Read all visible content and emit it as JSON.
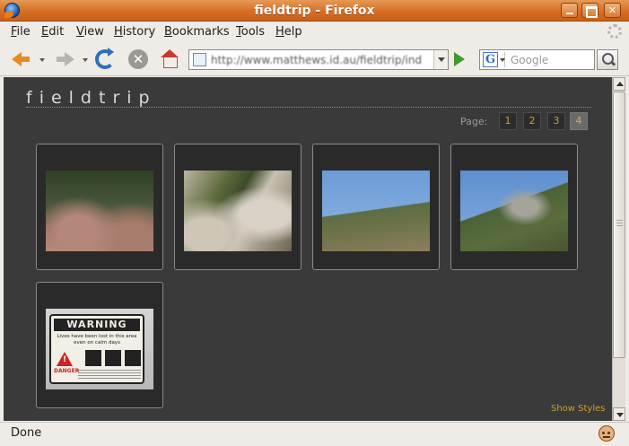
{
  "window": {
    "title": "fieldtrip - Firefox",
    "app_icon": "firefox-globe-icon"
  },
  "menubar": {
    "items": [
      {
        "label": "File",
        "accel": "F",
        "rest": "ile"
      },
      {
        "label": "Edit",
        "accel": "E",
        "rest": "dit"
      },
      {
        "label": "View",
        "accel": "V",
        "rest": "iew"
      },
      {
        "label": "History",
        "accel": "H",
        "rest": "istory"
      },
      {
        "label": "Bookmarks",
        "accel": "B",
        "rest": "ookmarks"
      },
      {
        "label": "Tools",
        "accel": "T",
        "rest": "ools"
      },
      {
        "label": "Help",
        "accel": "H",
        "rest": "elp"
      }
    ]
  },
  "navbar": {
    "url": "http://www.matthews.id.au/fieldtrip/ind",
    "search_placeholder": "Google",
    "search_engine_letter": "G"
  },
  "page": {
    "site_title": "fieldtrip",
    "pager_label": "Page:",
    "pages": [
      "1",
      "2",
      "3",
      "4"
    ],
    "current_page": "4",
    "show_styles": "Show Styles",
    "thumbnails": [
      {
        "subject": "rocks-and-scrub"
      },
      {
        "subject": "grass-on-rock-crevice"
      },
      {
        "subject": "hillside-under-sky"
      },
      {
        "subject": "granite-hill-under-sky"
      },
      {
        "subject": "warning-sign"
      }
    ],
    "warning_sign": {
      "heading": "WARNING",
      "line1": "Lives have been lost in this area",
      "line2": "even on calm days",
      "danger": "DANGER"
    }
  },
  "status": {
    "text": "Done"
  },
  "colors": {
    "titlebar": "#d76e23",
    "page_background": "#3a3a3a",
    "accent_gold": "#c9a227"
  }
}
